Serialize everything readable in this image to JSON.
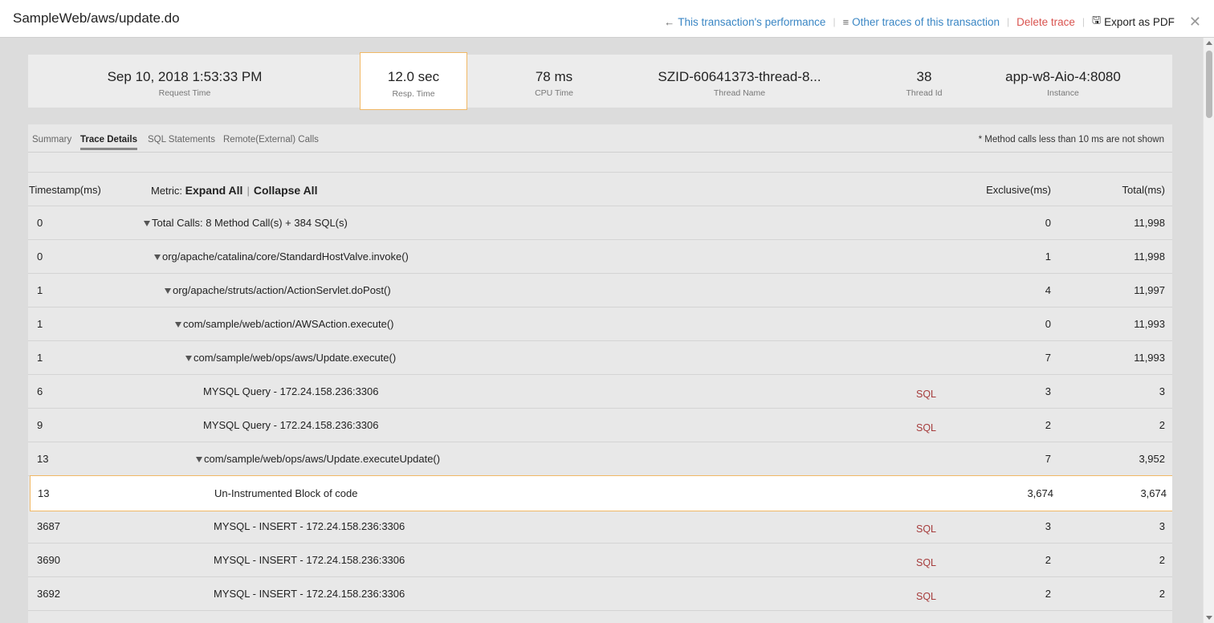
{
  "header": {
    "title": "SampleWeb/aws/update.do",
    "performance_label": "This transaction's performance",
    "other_traces_label": "Other traces of this transaction",
    "delete_label": "Delete trace",
    "export_label": "Export as PDF",
    "separator": "|",
    "close_glyph": "✕"
  },
  "icons": {
    "performance": "←",
    "traces": "≡",
    "export": "🖫"
  },
  "summary": {
    "request_time": {
      "value": "Sep 10, 2018 1:53:33 PM",
      "label": "Request Time"
    },
    "resp_time": {
      "value": "12.0 sec",
      "label": "Resp. Time"
    },
    "cpu_time": {
      "value": "78 ms",
      "label": "CPU Time"
    },
    "thread_name": {
      "value": "SZID-60641373-thread-8...",
      "label": "Thread Name"
    },
    "thread_id": {
      "value": "38",
      "label": "Thread Id"
    },
    "instance": {
      "value": "app-w8-Aio-4:8080",
      "label": "Instance"
    }
  },
  "tabs": [
    {
      "label": "Summary"
    },
    {
      "label": "Trace Details"
    },
    {
      "label": "SQL Statements"
    },
    {
      "label": "Remote(External) Calls"
    }
  ],
  "tab_note": "* Method calls less than 10 ms are not shown",
  "table": {
    "col_timestamp": "Timestamp(ms)",
    "metric_label": "Metric:",
    "expand_all": "Expand All",
    "collapse_all": "Collapse All",
    "sep": "|",
    "col_exclusive": "Exclusive(ms)",
    "col_total": "Total(ms)",
    "rows": [
      {
        "ts": "0",
        "metric": "Total Calls: 8 Method Call(s) + 384 SQL(s)",
        "sql": "",
        "excl": "0",
        "total": "11,998"
      },
      {
        "ts": "0",
        "metric": "org/apache/catalina/core/StandardHostValve.invoke()",
        "sql": "",
        "excl": "1",
        "total": "11,998"
      },
      {
        "ts": "1",
        "metric": "org/apache/struts/action/ActionServlet.doPost()",
        "sql": "",
        "excl": "4",
        "total": "11,997"
      },
      {
        "ts": "1",
        "metric": "com/sample/web/action/AWSAction.execute()",
        "sql": "",
        "excl": "0",
        "total": "11,993"
      },
      {
        "ts": "1",
        "metric": "com/sample/web/ops/aws/Update.execute()",
        "sql": "",
        "excl": "7",
        "total": "11,993"
      },
      {
        "ts": "6",
        "metric": "MYSQL Query - 172.24.158.236:3306",
        "sql": "SQL",
        "excl": "3",
        "total": "3"
      },
      {
        "ts": "9",
        "metric": "MYSQL Query - 172.24.158.236:3306",
        "sql": "SQL",
        "excl": "2",
        "total": "2"
      },
      {
        "ts": "13",
        "metric": "com/sample/web/ops/aws/Update.executeUpdate()",
        "sql": "",
        "excl": "7",
        "total": "3,952"
      },
      {
        "ts": "13",
        "metric": "Un-Instrumented Block of code",
        "sql": "",
        "excl": "3,674",
        "total": "3,674"
      },
      {
        "ts": "3687",
        "metric": "MYSQL - INSERT - 172.24.158.236:3306",
        "sql": "SQL",
        "excl": "3",
        "total": "3"
      },
      {
        "ts": "3690",
        "metric": "MYSQL - INSERT - 172.24.158.236:3306",
        "sql": "SQL",
        "excl": "2",
        "total": "2"
      },
      {
        "ts": "3692",
        "metric": "MYSQL - INSERT - 172.24.158.236:3306",
        "sql": "SQL",
        "excl": "2",
        "total": "2"
      }
    ]
  }
}
